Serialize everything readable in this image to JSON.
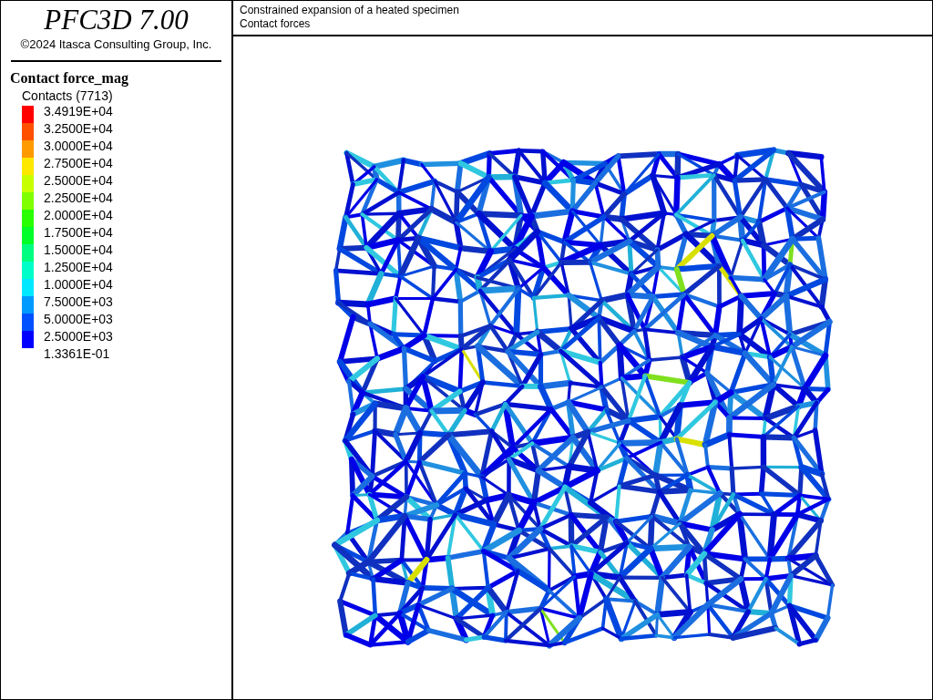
{
  "title_panel": {
    "product": "PFC3D 7.00",
    "copyright": "©2024 Itasca Consulting Group, Inc."
  },
  "legend": {
    "title": "Contact force_mag",
    "subtitle": "Contacts (7713)",
    "labels": [
      "3.4919E+04",
      "3.2500E+04",
      "3.0000E+04",
      "2.7500E+04",
      "2.5000E+04",
      "2.2500E+04",
      "2.0000E+04",
      "1.7500E+04",
      "1.5000E+04",
      "1.2500E+04",
      "1.0000E+04",
      "7.5000E+03",
      "5.0000E+03",
      "2.5000E+03",
      "1.3361E-01"
    ],
    "bands": [
      {
        "color": "#ff0000"
      },
      {
        "color": "#ff5000"
      },
      {
        "color": "#ff9a00"
      },
      {
        "color": "#ffe800"
      },
      {
        "color": "#c8ff00"
      },
      {
        "color": "#80ff00"
      },
      {
        "color": "#28ff00"
      },
      {
        "color": "#00ff28"
      },
      {
        "color": "#00ff80"
      },
      {
        "color": "#00ffc8"
      },
      {
        "color": "#00e8ff"
      },
      {
        "color": "#009aff"
      },
      {
        "color": "#0050ff"
      },
      {
        "color": "#0000ff"
      }
    ]
  },
  "plot": {
    "title": "Constrained expansion of a heated specimen",
    "subtitle": "Contact forces"
  }
}
